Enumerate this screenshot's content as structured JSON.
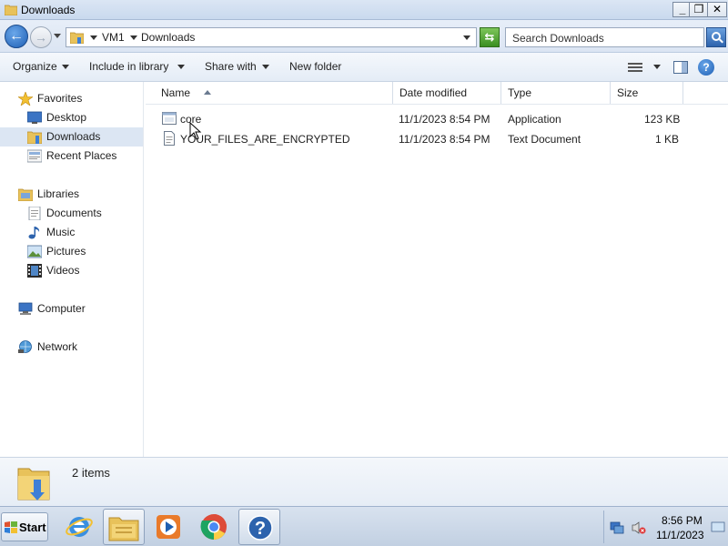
{
  "window": {
    "title": "Downloads",
    "minimize": "_",
    "maximize": "❐",
    "close": "✕"
  },
  "address": {
    "crumbs": [
      "VM1",
      "Downloads"
    ],
    "search_placeholder": "Search Downloads"
  },
  "toolbar": {
    "organize": "Organize",
    "include_in_library": "Include in library",
    "share_with": "Share with",
    "new_folder": "New folder"
  },
  "navigation": {
    "favorites": {
      "label": "Favorites",
      "items": [
        {
          "label": "Desktop",
          "icon": "desktop-icon"
        },
        {
          "label": "Downloads",
          "icon": "downloads-folder-icon",
          "selected": true
        },
        {
          "label": "Recent Places",
          "icon": "recent-places-icon"
        }
      ]
    },
    "libraries": {
      "label": "Libraries",
      "items": [
        {
          "label": "Documents",
          "icon": "documents-icon"
        },
        {
          "label": "Music",
          "icon": "music-icon"
        },
        {
          "label": "Pictures",
          "icon": "pictures-icon"
        },
        {
          "label": "Videos",
          "icon": "videos-icon"
        }
      ]
    },
    "computer": {
      "label": "Computer"
    },
    "network": {
      "label": "Network"
    }
  },
  "file_list": {
    "columns": [
      "Name",
      "Date modified",
      "Type",
      "Size"
    ],
    "sort_column": "Name",
    "rows": [
      {
        "name": "core",
        "date": "11/1/2023 8:54 PM",
        "type": "Application",
        "size": "123 KB",
        "icon": "application-icon"
      },
      {
        "name": "YOUR_FILES_ARE_ENCRYPTED",
        "date": "11/1/2023 8:54 PM",
        "type": "Text Document",
        "size": "1 KB",
        "icon": "text-document-icon"
      }
    ]
  },
  "details": {
    "item_count": "2 items"
  },
  "taskbar": {
    "start_label": "Start",
    "pinned": [
      "internet-explorer-icon",
      "windows-explorer-icon",
      "media-player-icon",
      "chrome-icon",
      "help-icon"
    ],
    "clock_time": "8:56 PM",
    "clock_date": "11/1/2023"
  },
  "colors": {
    "selection": "#dce6f3",
    "title_bar": "#c9d9ee",
    "taskbar": "#c2d0e2"
  }
}
